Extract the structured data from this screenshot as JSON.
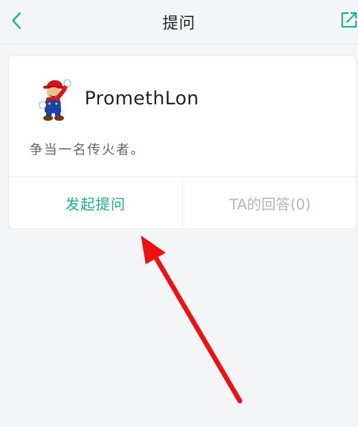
{
  "header": {
    "title": "提问",
    "back_icon": "chevron-left-icon",
    "share_icon": "share-external-icon",
    "accent_color": "#1aae92"
  },
  "profile": {
    "username": "PromethLon",
    "bio": "争当一名传火者。",
    "avatar_icon": "mario-avatar"
  },
  "actions": {
    "ask_label": "发起提问",
    "answers_label": "TA的回答(0)"
  },
  "annotation": {
    "arrow_color": "#ee1111"
  }
}
